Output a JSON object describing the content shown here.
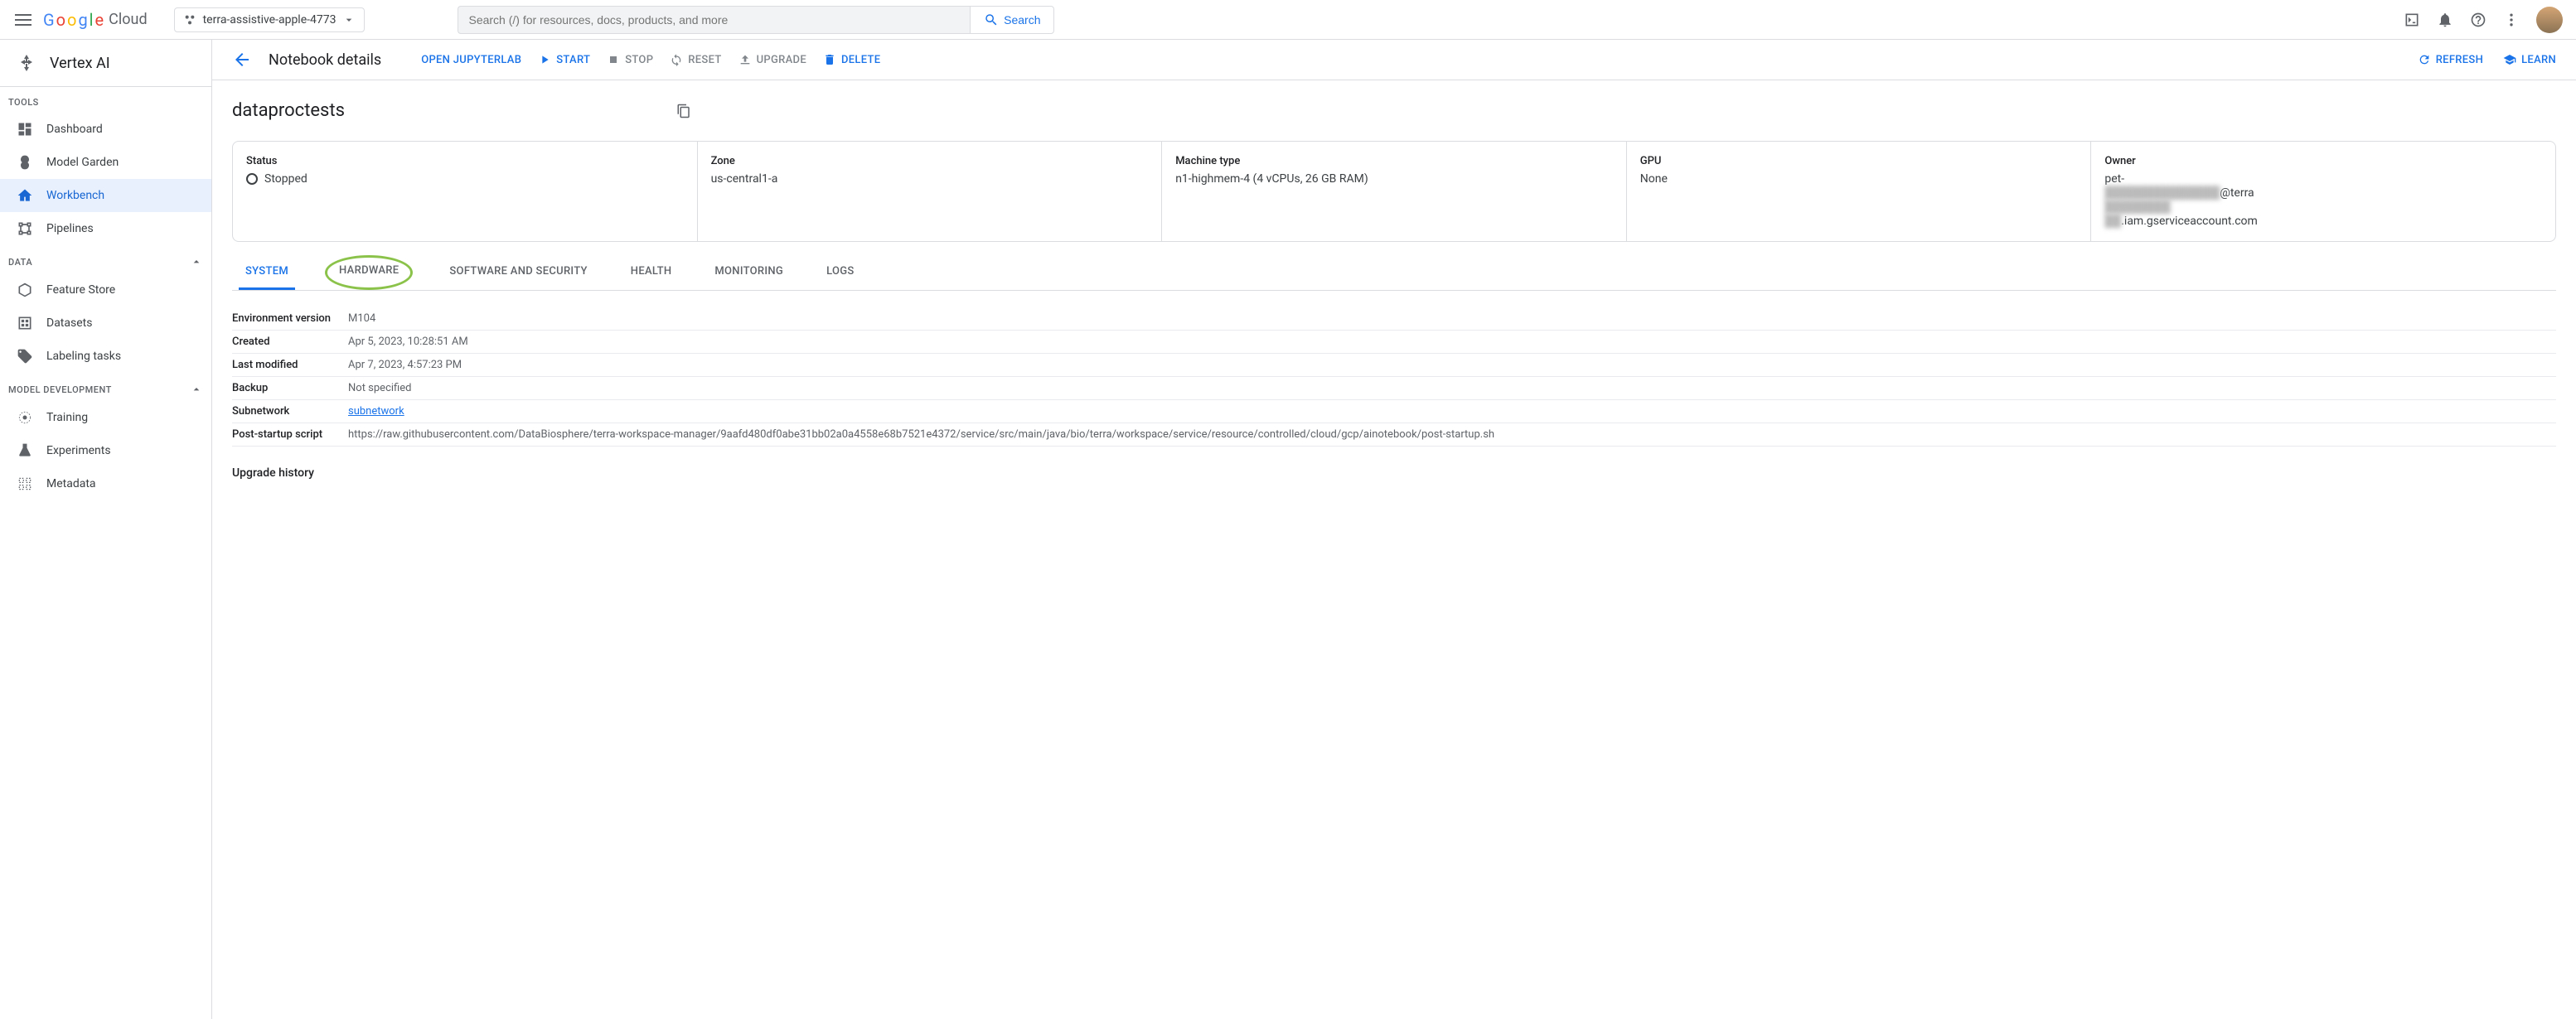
{
  "header": {
    "project_name": "terra-assistive-apple-4773",
    "search_placeholder": "Search (/) for resources, docs, products, and more",
    "search_button": "Search",
    "logo_cloud": "Cloud"
  },
  "sidebar": {
    "product": "Vertex AI",
    "sections": [
      {
        "title": "TOOLS",
        "items": [
          "Dashboard",
          "Model Garden",
          "Workbench",
          "Pipelines"
        ]
      },
      {
        "title": "DATA",
        "items": [
          "Feature Store",
          "Datasets",
          "Labeling tasks"
        ]
      },
      {
        "title": "MODEL DEVELOPMENT",
        "items": [
          "Training",
          "Experiments",
          "Metadata"
        ]
      }
    ]
  },
  "action_bar": {
    "title": "Notebook details",
    "open_jl": "OPEN JUPYTERLAB",
    "start": "START",
    "stop": "STOP",
    "reset": "RESET",
    "upgrade": "UPGRADE",
    "delete": "DELETE",
    "refresh": "REFRESH",
    "learn": "LEARN"
  },
  "resource": {
    "name": "dataproctests",
    "status_label": "Status",
    "status_value": "Stopped",
    "zone_label": "Zone",
    "zone_value": "us-central1-a",
    "machine_label": "Machine type",
    "machine_value": "n1-highmem-4 (4 vCPUs, 26 GB RAM)",
    "gpu_label": "GPU",
    "gpu_value": "None",
    "owner_label": "Owner",
    "owner_value_prefix": "pet-",
    "owner_value_suffix": "@terra",
    "owner_value_line3": ".iam.gserviceaccount.com"
  },
  "tabs": [
    "SYSTEM",
    "HARDWARE",
    "SOFTWARE AND SECURITY",
    "HEALTH",
    "MONITORING",
    "LOGS"
  ],
  "details": {
    "env_version_k": "Environment version",
    "env_version_v": "M104",
    "created_k": "Created",
    "created_v": "Apr 5, 2023, 10:28:51 AM",
    "modified_k": "Last modified",
    "modified_v": "Apr 7, 2023, 4:57:23 PM",
    "backup_k": "Backup",
    "backup_v": "Not specified",
    "subnet_k": "Subnetwork",
    "subnet_v": "subnetwork",
    "script_k": "Post-startup script",
    "script_v": "https://raw.githubusercontent.com/DataBiosphere/terra-workspace-manager/9aafd480df0abe31bb02a0a4558e68b7521e4372/service/src/main/java/bio/terra/workspace/service/resource/controlled/cloud/gcp/ainotebook/post-startup.sh"
  },
  "upgrade_history": "Upgrade history"
}
